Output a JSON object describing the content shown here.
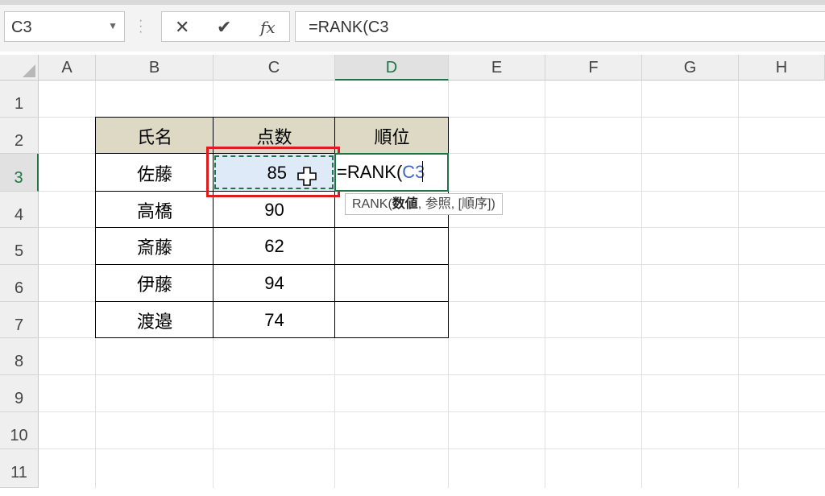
{
  "namebox": {
    "value": "C3"
  },
  "formula_bar": {
    "cancel_icon": "✕",
    "enter_icon": "✔",
    "fx_label": "fx",
    "formula": "=RANK(C3"
  },
  "columns": [
    "A",
    "B",
    "C",
    "D",
    "E",
    "F",
    "G",
    "H"
  ],
  "active_column": "D",
  "rows": [
    "1",
    "2",
    "3",
    "4",
    "5",
    "6",
    "7",
    "8",
    "9",
    "10",
    "11"
  ],
  "active_row": "3",
  "table": {
    "headers": {
      "name": "氏名",
      "score": "点数",
      "rank": "順位"
    },
    "records": [
      {
        "name": "佐藤",
        "score": "85"
      },
      {
        "name": "高橋",
        "score": "90"
      },
      {
        "name": "斎藤",
        "score": "62"
      },
      {
        "name": "伊藤",
        "score": "94"
      },
      {
        "name": "渡邉",
        "score": "74"
      }
    ]
  },
  "editing": {
    "prefix": "=RANK(",
    "ref": "C3"
  },
  "tooltip": {
    "func": "RANK(",
    "arg1": "数値",
    "rest": ", 参照, [順序])"
  },
  "colors": {
    "accent": "#217346",
    "header_fill": "#ddd9c4",
    "highlight": "#e01b1b",
    "ref": "#3a68c6"
  }
}
